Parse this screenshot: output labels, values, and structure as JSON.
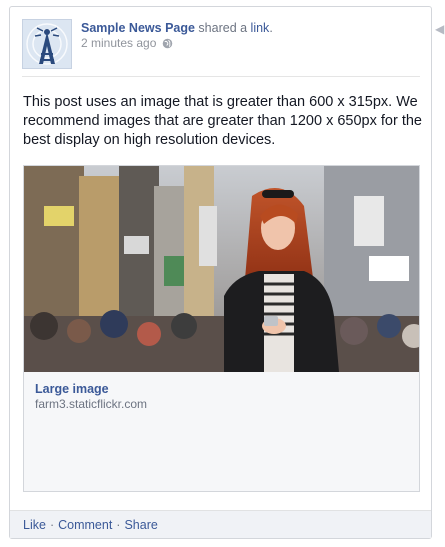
{
  "post": {
    "page_name": "Sample News Page",
    "shared_text": " shared a ",
    "link_word": "link",
    "period": ".",
    "timestamp": "2 minutes ago",
    "body": "This post uses an image that is greater than 600 x 315px. We recommend images that are greater than 1200 x 650px for the best display on high resolution devices."
  },
  "link_preview": {
    "title": "Large image",
    "domain": "farm3.staticflickr.com"
  },
  "actions": {
    "like": "Like",
    "comment": "Comment",
    "share": "Share",
    "separator": "·"
  },
  "colors": {
    "link_blue": "#3b5998",
    "meta_gray": "#90949c",
    "action_bar_bg": "#f0f2f6"
  },
  "icons": [
    "news-tower-logo-icon",
    "globe-icon",
    "chevron-icon"
  ]
}
